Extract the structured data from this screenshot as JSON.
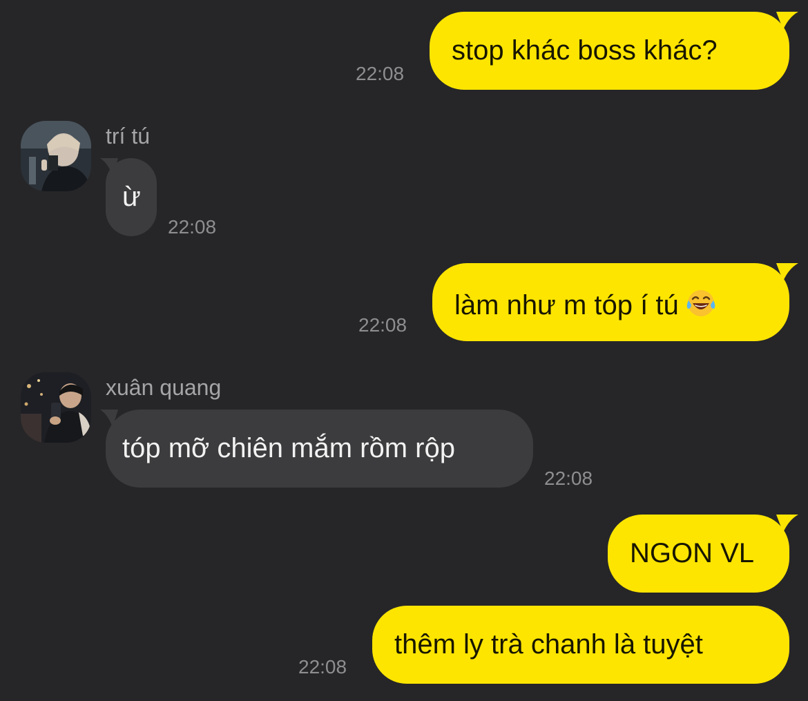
{
  "chat": {
    "messages": [
      {
        "side": "out",
        "text": "stop khác boss khác?",
        "time": "22:08"
      },
      {
        "side": "in",
        "sender": "trí tú",
        "text": "ừ",
        "time": "22:08"
      },
      {
        "side": "out",
        "text": "làm như m tóp í tú",
        "emoji": "😂",
        "time": "22:08"
      },
      {
        "side": "in",
        "sender": "xuân quang",
        "text": "tóp mỡ chiên mắm rồm rộp",
        "time": "22:08"
      },
      {
        "side": "out",
        "text": "NGON VL"
      },
      {
        "side": "out",
        "text": "thêm ly trà chanh là tuyệt",
        "time": "22:08"
      }
    ]
  },
  "colors": {
    "background": "#262628",
    "outgoing_bubble": "#FEE500",
    "incoming_bubble": "#3C3C3E",
    "timestamp": "#8E8E90"
  },
  "icons": {
    "emoji_0": "face-with-tears-of-joy-icon",
    "avatar_tri_tu": "user-avatar-photo",
    "avatar_xuan_quang": "user-avatar-photo"
  }
}
